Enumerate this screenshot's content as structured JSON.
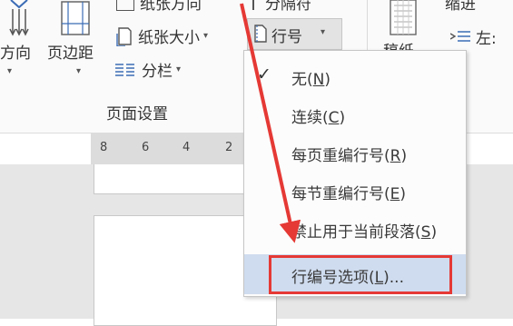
{
  "ribbon": {
    "orientation_label": "方向",
    "margins_label": "页边距",
    "paper_direction_label": "纸张方向",
    "paper_size_label": "纸张大小",
    "columns_label": "分栏",
    "breaks_label": "分隔符",
    "line_numbers_label": "行号",
    "manuscript_label": "稿纸",
    "indent_label": "缩进",
    "indent_left_label": "左:",
    "group_label": "页面设置"
  },
  "ruler": {
    "ticks": [
      "8",
      "6",
      "4",
      "2"
    ]
  },
  "menu": {
    "items": [
      {
        "label": "无",
        "key": "N",
        "checked": true
      },
      {
        "label": "连续",
        "key": "C"
      },
      {
        "label": "每页重编行号",
        "key": "R"
      },
      {
        "label": "每节重编行号",
        "key": "E"
      },
      {
        "label": "禁止用于当前段落",
        "key": "S"
      },
      {
        "label": "行编号选项",
        "key": "L",
        "suffix": "...",
        "highlighted": true
      }
    ]
  },
  "colors": {
    "highlight_box": "#e53935",
    "arrow": "#e53935",
    "menu_selected_bg": "#cfdcef"
  }
}
